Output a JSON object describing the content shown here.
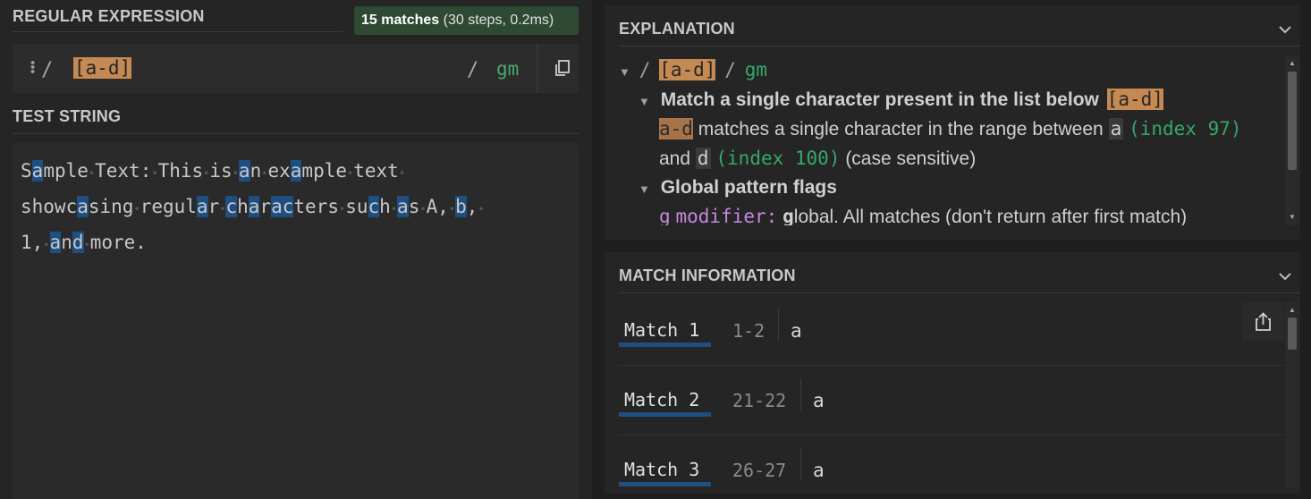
{
  "regex_section": {
    "title": "REGULAR EXPRESSION",
    "badge_count": "15 matches",
    "badge_detail": "(30 steps, 0.2ms)",
    "delimiter": "/",
    "pattern": "[a-d]",
    "flags": "gm"
  },
  "test_section": {
    "title": "TEST STRING",
    "lines": [
      "Sample Text: This is an example text",
      "showcasing regular characters such as A, b,",
      "1, and more."
    ]
  },
  "explanation": {
    "title": "EXPLANATION",
    "root_slash": "/",
    "root_pattern": "[a-d]",
    "root_flags": "gm",
    "item1_title": "Match a single character present in the list below",
    "item1_token": "[a-d]",
    "range_token": "a-d",
    "range_text": "matches a single character in the range between",
    "range_from": "a",
    "range_from_index": "(index 97)",
    "and_word": "and",
    "range_to": "d",
    "range_to_index": "(index 100)",
    "case_note": "(case sensitive)",
    "item2_title": "Global pattern flags",
    "flag_g": "g",
    "flag_g_label": "modifier:",
    "flag_g_first": "g",
    "flag_g_desc": "lobal. All matches (don't return after first match)"
  },
  "match_info": {
    "title": "MATCH INFORMATION",
    "matches": [
      {
        "label": "Match 1",
        "range": "1-2",
        "value": "a"
      },
      {
        "label": "Match 2",
        "range": "21-22",
        "value": "a"
      },
      {
        "label": "Match 3",
        "range": "26-27",
        "value": "a"
      }
    ]
  },
  "colors": {
    "accent_blue": "#1f4f80",
    "regex_highlight": "#c58a54",
    "flags_green": "#4aaa6e",
    "badge_bg": "#2f4a33"
  },
  "icons": [
    "drag-handle-icon",
    "copy-icon",
    "chevron-down-icon",
    "triangle-down-icon",
    "export-icon"
  ]
}
